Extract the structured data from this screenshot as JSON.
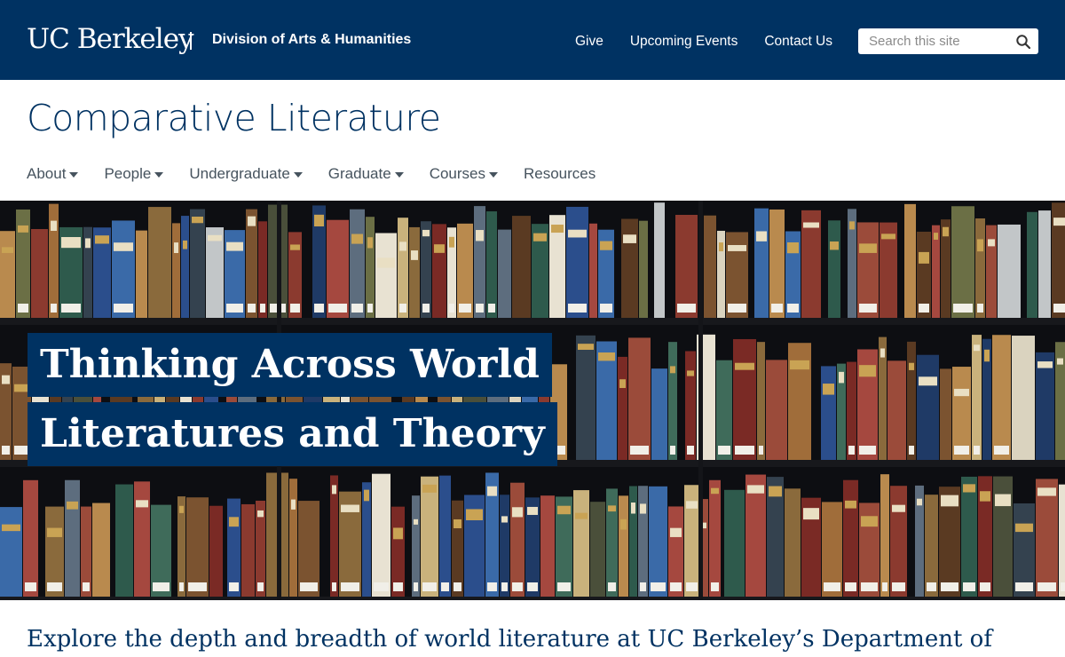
{
  "header": {
    "logo_text": "UC Berkeley",
    "division": "Division of Arts & Humanities",
    "utility_links": [
      "Give",
      "Upcoming Events",
      "Contact Us"
    ],
    "search": {
      "placeholder": "Search this site",
      "value": ""
    }
  },
  "site": {
    "title": "Comparative Literature",
    "nav": [
      {
        "label": "About",
        "dropdown": true
      },
      {
        "label": "People",
        "dropdown": true
      },
      {
        "label": "Undergraduate",
        "dropdown": true
      },
      {
        "label": "Graduate",
        "dropdown": true
      },
      {
        "label": "Courses",
        "dropdown": true
      },
      {
        "label": "Resources",
        "dropdown": false
      }
    ]
  },
  "hero": {
    "line1": "Thinking Across World",
    "line2": "Literatures and Theory",
    "image": "bookshelf-photo"
  },
  "intro": {
    "text": "Explore the depth and breadth of world literature at UC Berkeley’s Department of"
  },
  "colors": {
    "berkeley_blue": "#003262",
    "nav_gray": "#46535e",
    "white": "#ffffff"
  }
}
